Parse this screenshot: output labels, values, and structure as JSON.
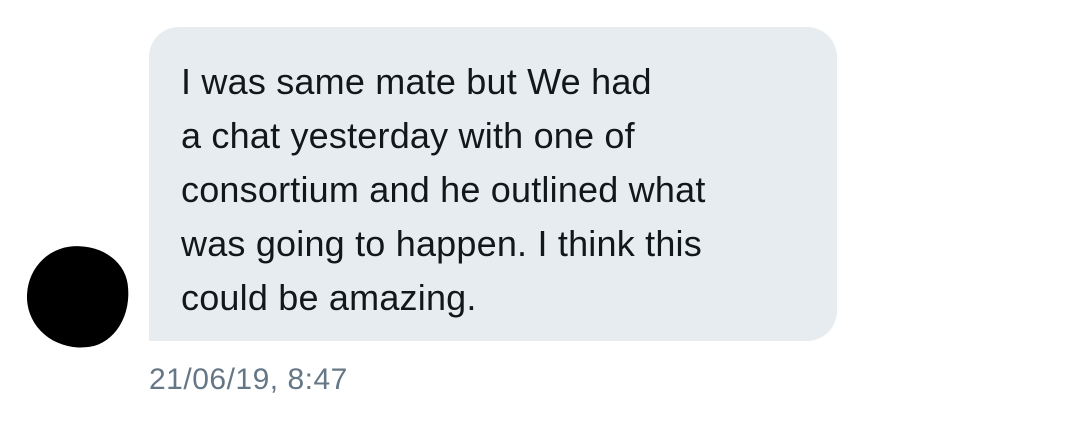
{
  "message": {
    "lines": [
      "I was same mate but We had",
      "a chat yesterday with one of",
      "consortium and he outlined what",
      "was going to happen. I think this",
      "could be amazing."
    ],
    "timestamp": "21/06/19, 8:47"
  },
  "sender": {
    "avatar_color": "#000000"
  },
  "colors": {
    "bubble_background": "#e6ecf0",
    "message_text": "#14171a",
    "timestamp_text": "#657786",
    "page_background": "#ffffff"
  }
}
